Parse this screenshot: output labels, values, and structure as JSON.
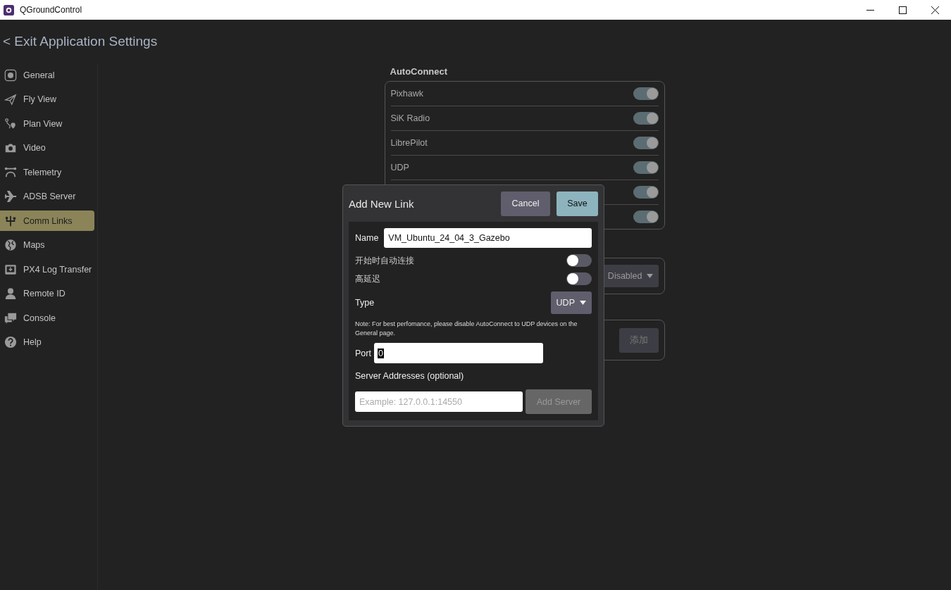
{
  "window": {
    "title": "QGroundControl"
  },
  "header": {
    "back_label": "< Exit Application Settings"
  },
  "sidebar": {
    "items": [
      {
        "label": "General",
        "kind": "logo",
        "selected": false
      },
      {
        "label": "Fly View",
        "kind": "plane",
        "selected": false
      },
      {
        "label": "Plan View",
        "kind": "route",
        "selected": false
      },
      {
        "label": "Video",
        "kind": "camera",
        "selected": false
      },
      {
        "label": "Telemetry",
        "kind": "telemetry",
        "selected": false
      },
      {
        "label": "ADSB Server",
        "kind": "airplane",
        "selected": false
      },
      {
        "label": "Comm Links",
        "kind": "usb",
        "selected": true
      },
      {
        "label": "Maps",
        "kind": "globe",
        "selected": false
      },
      {
        "label": "PX4 Log Transfer",
        "kind": "download",
        "selected": false
      },
      {
        "label": "Remote ID",
        "kind": "person",
        "selected": false
      },
      {
        "label": "Console",
        "kind": "chat",
        "selected": false
      },
      {
        "label": "Help",
        "kind": "help",
        "selected": false
      }
    ]
  },
  "autoconnect": {
    "title": "AutoConnect",
    "rows": [
      {
        "label": "Pixhawk",
        "on": true
      },
      {
        "label": "SiK Radio",
        "on": true
      },
      {
        "label": "LibrePilot",
        "on": true
      },
      {
        "label": "UDP",
        "on": true
      },
      {
        "on": true
      },
      {
        "on": true
      }
    ]
  },
  "nmea_group": {
    "dropdown": "Disabled"
  },
  "links_group": {
    "add_button": "添加",
    "disabled": true
  },
  "dialog": {
    "title": "Add New Link",
    "cancel": "Cancel",
    "save": "Save",
    "name_label": "Name",
    "name_value": "VM_Ubuntu_24_04_3_Gazebo",
    "toggles": [
      {
        "label": "开始时自动连接",
        "on": false
      },
      {
        "label": "高延迟",
        "on": false
      }
    ],
    "type_label": "Type",
    "type_value": "UDP",
    "note": "Note: For best perfomance, please disable AutoConnect to UDP devices on the General page.",
    "port_label": "Port",
    "port_value": "0",
    "servers_label": "Server Addresses (optional)",
    "server_placeholder": "Example: 127.0.0.1:14550",
    "add_server": "Add Server",
    "add_server_disabled": true
  }
}
